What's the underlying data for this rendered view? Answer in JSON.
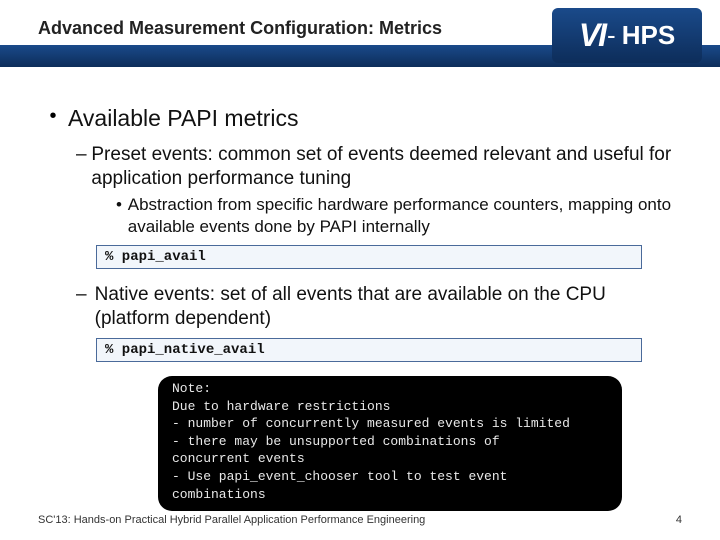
{
  "header": {
    "title": "Advanced Measurement Configuration: Metrics",
    "logo_v": "VI",
    "logo_dash": "-",
    "logo_hps": "HPS"
  },
  "content": {
    "l1": "Available PAPI metrics",
    "preset": {
      "heading": "Preset events: common set of events deemed relevant and useful for application performance tuning",
      "sub": "Abstraction from specific hardware performance counters, mapping onto available events done by PAPI internally",
      "cmd": "% papi_avail"
    },
    "native": {
      "heading": "Native events: set of all events that are available on the CPU (platform dependent)",
      "cmd": "% papi_native_avail"
    },
    "note": {
      "l0": "Note:",
      "l1": "Due to hardware restrictions",
      "l2": "- number of concurrently measured events is limited",
      "l3": "- there may be unsupported combinations of",
      "l4": "  concurrent events",
      "l5": "- Use papi_event_chooser tool to test event",
      "l6": "  combinations"
    }
  },
  "footer": {
    "left": "SC'13: Hands-on Practical Hybrid Parallel Application Performance Engineering",
    "right": "4"
  }
}
